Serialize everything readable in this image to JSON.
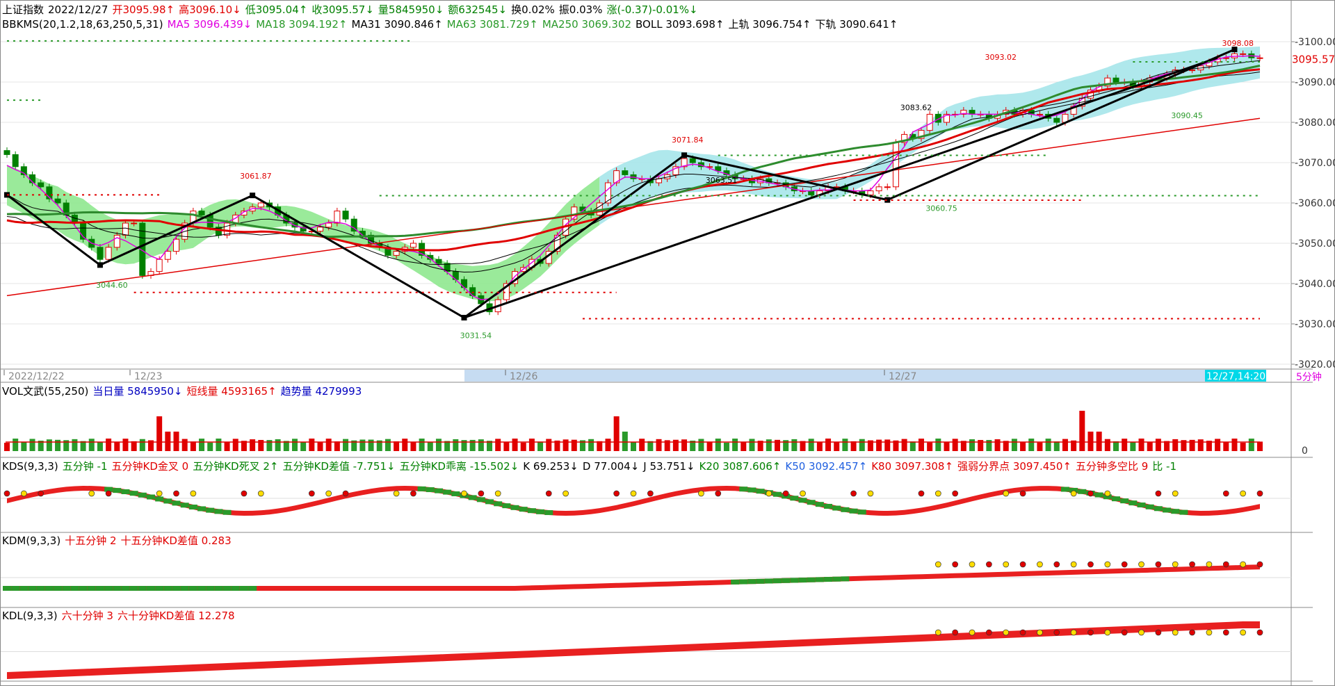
{
  "header": {
    "line1": {
      "name": "上证指数",
      "date": "2022/12/27",
      "open": "开3095.98↑",
      "high": "高3096.10↓",
      "low": "低3095.04↑",
      "close": "收3095.57↓",
      "volume": "量5845950↓",
      "amount": "额632545↓",
      "turnover": "换0.02%",
      "amplitude": "振0.03%",
      "change": "涨(-0.37)-0.01%↓"
    },
    "line2": {
      "name": "BBKMS(20,1.2,18,63,250,5,31)",
      "ma5": "MA5 3096.439↓",
      "ma18": "MA18 3094.192↑",
      "ma31": "MA31 3090.846↑",
      "ma63": "MA63 3081.729↑",
      "ma250": "MA250 3069.302",
      "boll": "BOLL 3093.698↑",
      "upper": "上轨 3096.754↑",
      "lower": "下轨 3090.641↑"
    }
  },
  "vol_header": {
    "name": "VOL文武(55,250)",
    "day_vol": "当日量 5845950↓",
    "short_vol": "短线量 4593165↑",
    "trend_vol": "趋势量 4279993"
  },
  "kds_header": {
    "name": "KDS(9,3,3)",
    "t1": "五分钟 -1",
    "t2": "五分钟KD金叉 0",
    "t3": "五分钟KD死叉 2↑",
    "t4": "五分钟KD差值 -7.751↓",
    "t5": "五分钟KD乖离 -15.502↓",
    "k": "K 69.253↓",
    "d": "D 77.004↓",
    "j": "J 53.751↓",
    "k20": "K20 3087.606↑",
    "k50": "K50 3092.457↑",
    "k80": "K80 3097.308↑",
    "strong": "强弱分界点 3097.450↑",
    "ratio": "五分钟多空比 9",
    "bi": "比 -1"
  },
  "kdm_header": {
    "name": "KDM(9,3,3)",
    "t1": "十五分钟 2",
    "t2": "十五分钟KD差值 0.283"
  },
  "kdl_header": {
    "name": "KDL(9,3,3)",
    "t1": "六十分钟 3",
    "t2": "六十分钟KD差值 12.278"
  },
  "axis": {
    "price_ticks": [
      "3100.00",
      "3090.00",
      "3080.00",
      "3070.00",
      "3060.00",
      "3050.00",
      "3040.00",
      "3030.00",
      "3020.00"
    ],
    "current_price": "3095.57",
    "vol_tick": "0",
    "kd_tick": "50",
    "dates": [
      "2022/12/22",
      "12/23",
      "12/26",
      "12/27"
    ],
    "cursor_time": "12/27,14:20",
    "period": "5分钟"
  },
  "annotations": [
    "3098.08",
    "3093.02",
    "3083.62",
    "3071.84",
    "3063.51",
    "3061.87",
    "3060.75",
    "3090.45",
    "3044.60",
    "3031.54"
  ],
  "chart_data": {
    "type": "candlestick",
    "ylim": [
      3020,
      3100
    ],
    "close_series": [
      3072,
      3069,
      3067,
      3065,
      3064,
      3061,
      3060,
      3057,
      3055,
      3051,
      3049,
      3046,
      3049,
      3052,
      3055,
      3055,
      3042,
      3043,
      3046,
      3048,
      3051,
      3055,
      3058,
      3057,
      3054,
      3052,
      3055,
      3057,
      3058,
      3059,
      3060,
      3059,
      3057,
      3055,
      3054,
      3053,
      3053,
      3054,
      3055,
      3058,
      3056,
      3053,
      3052,
      3050,
      3049,
      3047,
      3048,
      3049,
      3050,
      3047,
      3046,
      3045,
      3043,
      3041,
      3039,
      3037,
      3035,
      3033,
      3036,
      3040,
      3043,
      3044,
      3046,
      3045,
      3048,
      3052,
      3056,
      3059,
      3058,
      3057,
      3060,
      3065,
      3068,
      3067,
      3066,
      3066,
      3065,
      3066,
      3067,
      3069,
      3071,
      3070,
      3069,
      3069,
      3068,
      3067,
      3066,
      3066,
      3065,
      3066,
      3065,
      3065,
      3064,
      3063,
      3063,
      3062,
      3063,
      3064,
      3064,
      3063,
      3063,
      3062,
      3063,
      3064,
      3064,
      3075,
      3077,
      3076,
      3078,
      3082,
      3080,
      3082,
      3082,
      3083,
      3082,
      3082,
      3081,
      3082,
      3083,
      3082,
      3083,
      3082,
      3082,
      3081,
      3080,
      3082,
      3084,
      3086,
      3088,
      3089,
      3091,
      3090,
      3090,
      3089,
      3090,
      3091,
      3091,
      3092,
      3093,
      3093,
      3093,
      3094,
      3095,
      3096,
      3096,
      3097,
      3097,
      3096,
      3096
    ],
    "ma250_endpoints": [
      [
        0,
        3037
      ],
      [
        1,
        3081
      ]
    ],
    "kd_ref": 50
  }
}
